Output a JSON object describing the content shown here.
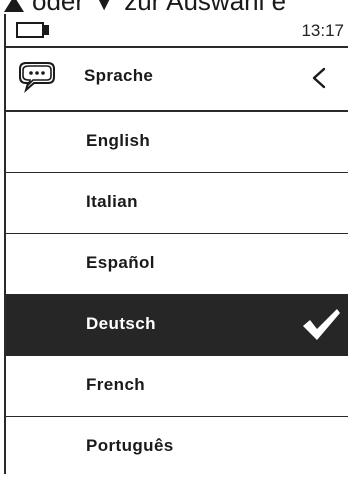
{
  "caption": {
    "text": "oder ▼ zur Auswahl e"
  },
  "status": {
    "battery_icon": "battery-icon",
    "time": "13:17"
  },
  "header": {
    "icon": "speech-bubble-icon",
    "title": "Sprache",
    "back_icon": "chevron-left-icon"
  },
  "languages": [
    {
      "label": "English",
      "selected": false
    },
    {
      "label": "Italian",
      "selected": false
    },
    {
      "label": "Español",
      "selected": false
    },
    {
      "label": "Deutsch",
      "selected": true
    },
    {
      "label": "French",
      "selected": false
    },
    {
      "label": "Português",
      "selected": false
    }
  ],
  "colors": {
    "selected_background": "#262626",
    "selected_text": "#ffffff",
    "text": "#1a1a1a"
  }
}
